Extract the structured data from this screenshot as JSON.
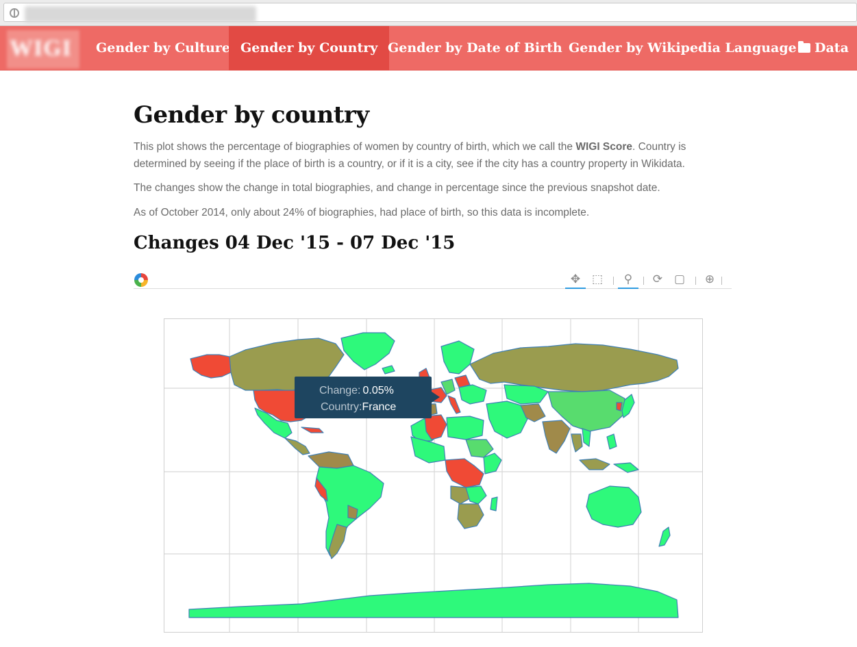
{
  "nav": {
    "brand": "WIGI",
    "items": [
      {
        "label": "Gender by Culture",
        "active": false
      },
      {
        "label": "Gender by Country",
        "active": true
      },
      {
        "label": "Gender by Date of Birth",
        "active": false
      },
      {
        "label": "Gender by Wikipedia Language",
        "active": false
      },
      {
        "label": "Data",
        "active": false,
        "icon": "folder-icon"
      }
    ]
  },
  "page": {
    "title": "Gender by country",
    "intro_before": "This plot shows the percentage of biographies of women by country of birth, which we call the ",
    "intro_bold": "WIGI Score",
    "intro_after": ". Country is determined by seeing if the place of birth is a country, or if it is a city, see if the city has a country property in Wikidata.",
    "changes_note": "The changes show the change in total biographies, and change in percentage since the previous snapshot date.",
    "coverage_note": "As of October 2014, only about 24% of biographies, had place of birth, so this data is incomplete.",
    "section_title": "Changes 04 Dec '15 - 07 Dec '15"
  },
  "toolbar": {
    "tools": [
      {
        "name": "pan-tool-icon",
        "glyph": "✥",
        "active": true
      },
      {
        "name": "box-zoom-tool-icon",
        "glyph": "⬚",
        "active": false
      },
      {
        "name": "wheel-zoom-tool-icon",
        "glyph": "⚲",
        "active": true
      },
      {
        "name": "reset-tool-icon",
        "glyph": "⟳",
        "active": false
      },
      {
        "name": "save-tool-icon",
        "glyph": "▢",
        "active": false
      },
      {
        "name": "hover-tool-icon",
        "glyph": "⊕",
        "active": false
      }
    ]
  },
  "map": {
    "colors": {
      "ocean": "#ffffff",
      "grid": "#d8d8d8",
      "border": "#3f7fb5",
      "high_green": "#2ef97b",
      "mid_green": "#58dc6e",
      "olive": "#9a9c4f",
      "brownish": "#a08a4a",
      "red": "#f04a35"
    },
    "tooltip": {
      "change_label": "Change:",
      "change_value": "0.05%",
      "country_label": "Country:",
      "country_value": "France"
    }
  }
}
